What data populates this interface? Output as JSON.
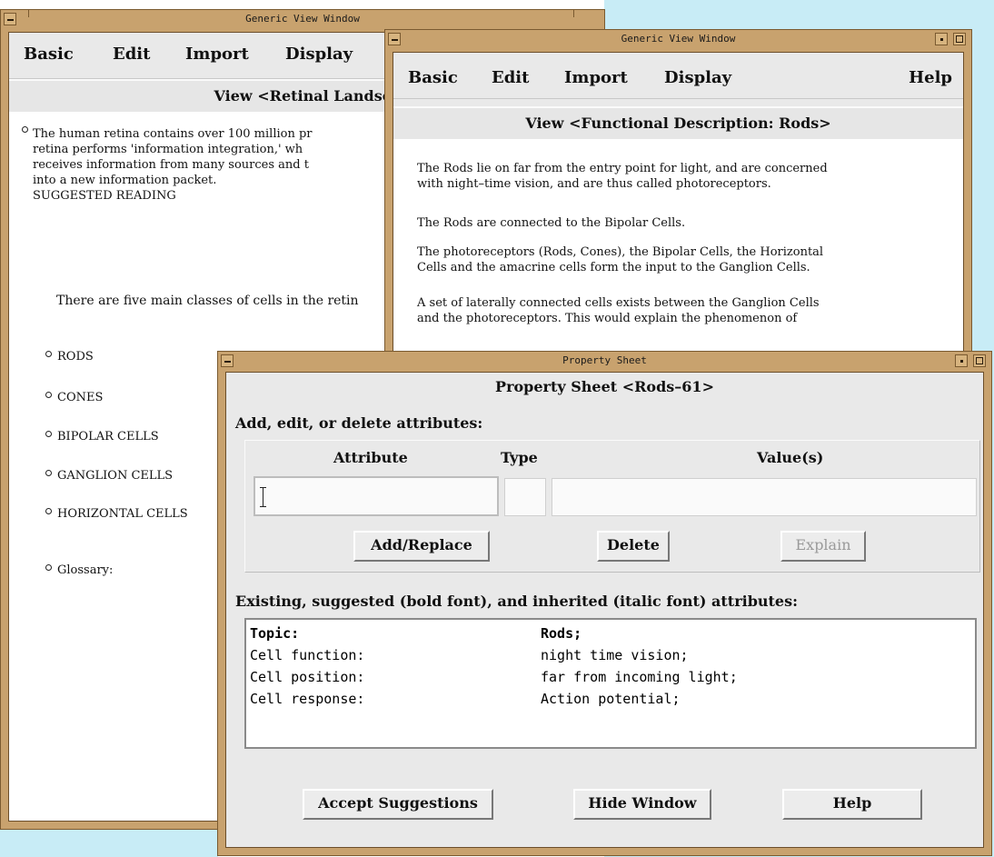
{
  "win1": {
    "title": "Generic View Window",
    "menu": [
      "Basic",
      "Edit",
      "Import",
      "Display"
    ],
    "view_header": "View <Retinal Landsc",
    "para": [
      "The human retina contains over 100 million pr",
      "retina performs 'information integration,' wh",
      "receives information from many sources and t",
      "into a new information packet.",
      "SUGGESTED READING"
    ],
    "classes_text": "There are five main classes of cells in the retin",
    "bullets": [
      "RODS",
      "CONES",
      "BIPOLAR CELLS",
      "GANGLION CELLS",
      "HORIZONTAL CELLS"
    ],
    "glossary": "Glossary:"
  },
  "win2": {
    "title": "Generic View Window",
    "menu": [
      "Basic",
      "Edit",
      "Import",
      "Display",
      "Help"
    ],
    "view_header": "View <Functional Description: Rods>",
    "p1": [
      "The Rods lie on far from the entry point for light, and are concerned",
      "with night–time vision, and are thus called photoreceptors."
    ],
    "p2": "The Rods are connected to the Bipolar Cells.",
    "p3": [
      "The photoreceptors (Rods, Cones), the Bipolar Cells, the Horizontal",
      "Cells and the amacrine cells form the input to the Ganglion Cells."
    ],
    "p4": [
      "A set of laterally connected cells exists between the Ganglion Cells",
      "and the photoreceptors.  This would explain the phenomenon of"
    ]
  },
  "win3": {
    "title": "Property Sheet",
    "heading": "Property Sheet <Rods–61>",
    "edit_label": "Add, edit, or delete attributes:",
    "col_attribute": "Attribute",
    "col_type": "Type",
    "col_values": "Value(s)",
    "attribute_value": "",
    "type_value": "",
    "values_value": "",
    "btn_add": "Add/Replace",
    "btn_delete": "Delete",
    "btn_explain": "Explain",
    "existing_label": "Existing, suggested (bold font), and inherited (italic font) attributes:",
    "rows": [
      {
        "attr": "Topic:",
        "value": "Rods;"
      },
      {
        "attr": "Cell function:",
        "value": "night time vision;"
      },
      {
        "attr": "Cell position:",
        "value": "far from incoming light;"
      },
      {
        "attr": "Cell response:",
        "value": "Action potential;"
      }
    ],
    "btn_accept": "Accept Suggestions",
    "btn_hide": "Hide Window",
    "btn_help": "Help"
  }
}
